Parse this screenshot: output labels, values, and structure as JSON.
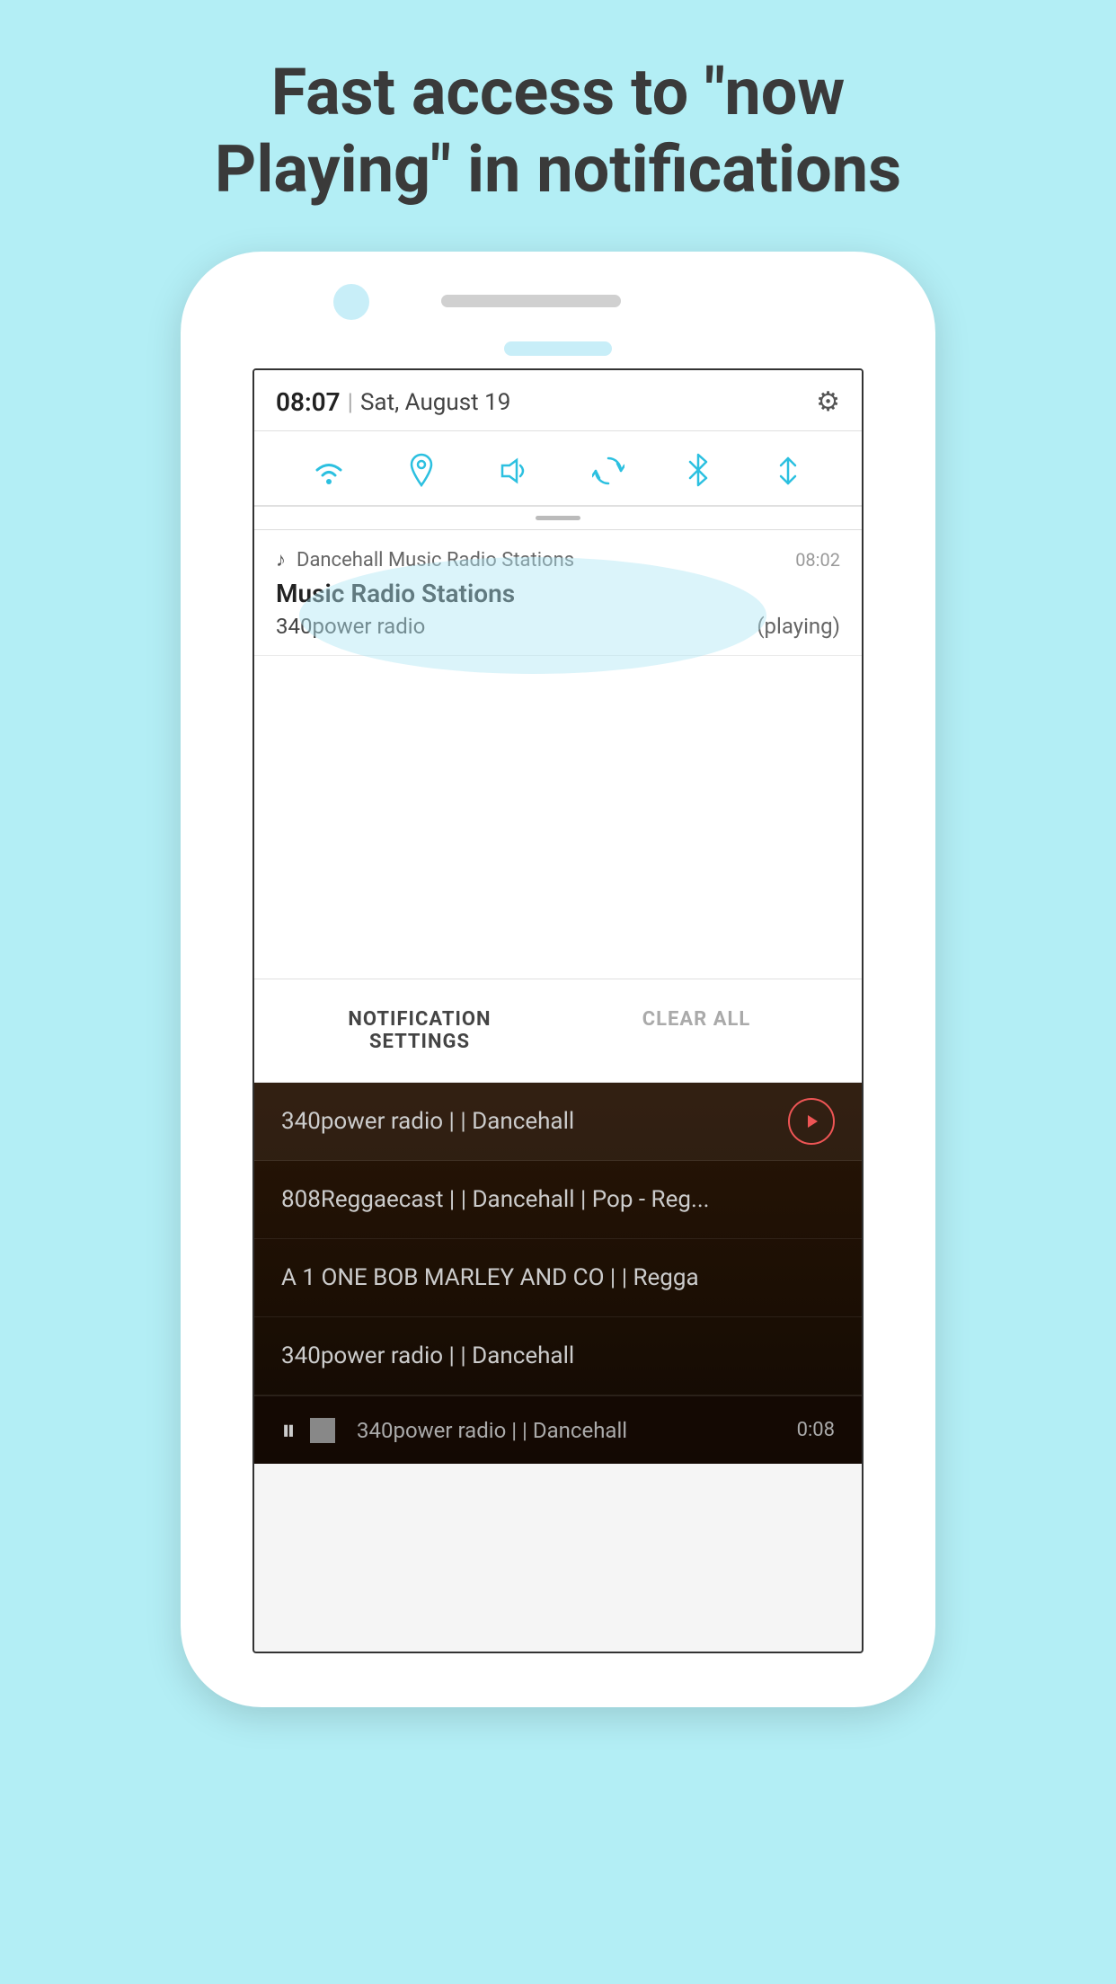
{
  "headline": {
    "line1": "Fast access to \"now",
    "line2": "Playing\" in notifications"
  },
  "status_bar": {
    "time": "08:07",
    "separator": "|",
    "date": "Sat, August 19",
    "gear_label": "⚙"
  },
  "quick_settings": {
    "icons": [
      "wifi",
      "location",
      "volume",
      "sync",
      "bluetooth",
      "data-transfer"
    ]
  },
  "notification": {
    "icon": "♪",
    "app_name": "Dancehall Music Radio Stations",
    "time": "08:02",
    "title": "Music Radio Stations",
    "station": "340power radio",
    "status": "(playing)"
  },
  "notif_actions": {
    "settings_label": "NOTIFICATION SETTINGS",
    "clear_label": "CLEAR ALL"
  },
  "stations": [
    {
      "name": "340power radio | | Dancehall",
      "has_play": true
    },
    {
      "name": "808Reggaecast | | Dancehall | Pop - Reg...",
      "has_play": false
    },
    {
      "name": "A 1 ONE BOB MARLEY AND CO | | Regga",
      "has_play": false
    },
    {
      "name": "340power radio | | Dancehall",
      "has_play": false
    }
  ],
  "playback": {
    "station": "340power radio | | Dancehall",
    "time": "0:08"
  }
}
